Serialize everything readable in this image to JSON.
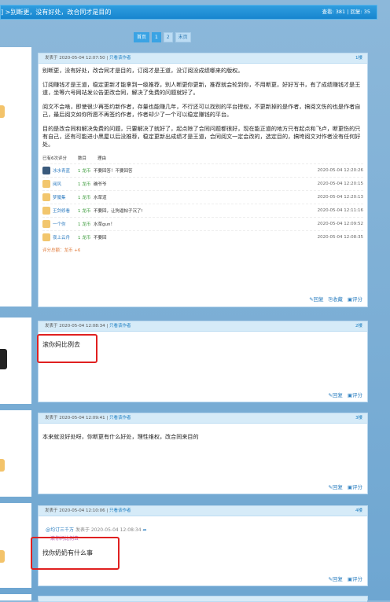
{
  "header": {
    "title": "] >别断更，没有好处，改合同才是目的",
    "stats": "查看: 381 | 回复: 35"
  },
  "pager": {
    "items": [
      "首页",
      "1",
      "2",
      "末页"
    ]
  },
  "posts": [
    {
      "meta": "发表于 2020-05-04 12:07:50 | ",
      "only_author": "只看该作者",
      "floor": "1楼",
      "paragraphs": [
        "别断更，没有好处，改合同才是目的，订阅才是王道，没订阅没成绩哪来的版权。",
        "订阅赚钱才是王道，稳定更新才能拿到一级推荐，别人断更你更新，推荐就会轮到你，不用断更，好好写书，有了成绩赚钱才是王道，坐等六号网站发公告更改合同，解决了免费的问题就好了。",
        "阅文不会啥，即使很少再签约新作者，存量也能赚几年，不行还可以找别的平台授权，不更新掉的是作者，搞阅文伤的也是作者自己，最后阅文如你所愿不再签约作者，作者却少了一个可以稳定赚钱的平台。",
        "目的是改合同和解决免费的问题，只要解决了就好了，起点除了合同问题都很好，现在能正道的地方只有起点和飞卢，断更伤的只有自己，还有可能进小黑屋以后没推荐，稳定更新出成绩才是王道，合同阅文一定会改的，选定目的，搞垮阅文对作者没有任何好处。"
      ],
      "rating": {
        "summary": "已有6次评分",
        "col_coin": "数目",
        "col_reason": "理由",
        "rows": [
          {
            "name": "冰水青蓝",
            "coin": "1 龙币",
            "reason": "不要回答！不要回答",
            "time": "2020-05-04 12:20:26"
          },
          {
            "name": "阅风",
            "coin": "1 龙币",
            "reason": "确爷爷",
            "time": "2020-05-04 12:20:15"
          },
          {
            "name": "梦魇集",
            "coin": "1 龙币",
            "reason": "水草道",
            "time": "2020-05-04 12:20:13"
          },
          {
            "name": "王剑修看",
            "coin": "1 龙币",
            "reason": "不要回，让狗逼帖子沉了!",
            "time": "2020-05-04 12:11:16"
          },
          {
            "name": "一个你",
            "coin": "1 龙币",
            "reason": "水草gun！",
            "time": "2020-05-04 12:09:52"
          },
          {
            "name": "夜上云舟",
            "coin": "1 龙币",
            "reason": "不要回",
            "time": "2020-05-04 12:08:35"
          }
        ],
        "total": "评分总额：龙币 +6"
      },
      "actions": [
        "回复",
        "收藏",
        "评分"
      ]
    },
    {
      "meta": "发表于 2020-05-04 12:08:34 | ",
      "only_author": "只看该作者",
      "floor": "2楼",
      "content": "滚你妈比例去",
      "actions": [
        "回复",
        "评分"
      ]
    },
    {
      "meta": "发表于 2020-05-04 12:09:41 | ",
      "only_author": "只看该作者",
      "floor": "3楼",
      "content": "本来就没好处呀，你断更有什么好处，理性维权，改合同来目的",
      "actions": [
        "回复",
        "评分"
      ]
    },
    {
      "meta": "发表于 2020-05-04 12:10:06 | ",
      "only_author": "只看该作者",
      "floor": "4楼",
      "quote_author": "@均订三千万",
      "quote_meta": "发表于 2020-05-04 12:08:34",
      "quote_text": "滚你妈比例去",
      "content": "找你奶奶有什么事",
      "actions": [
        "回复",
        "评分"
      ]
    }
  ],
  "colors": {
    "accent": "#1785cf",
    "highlight_box": "#e02020"
  }
}
